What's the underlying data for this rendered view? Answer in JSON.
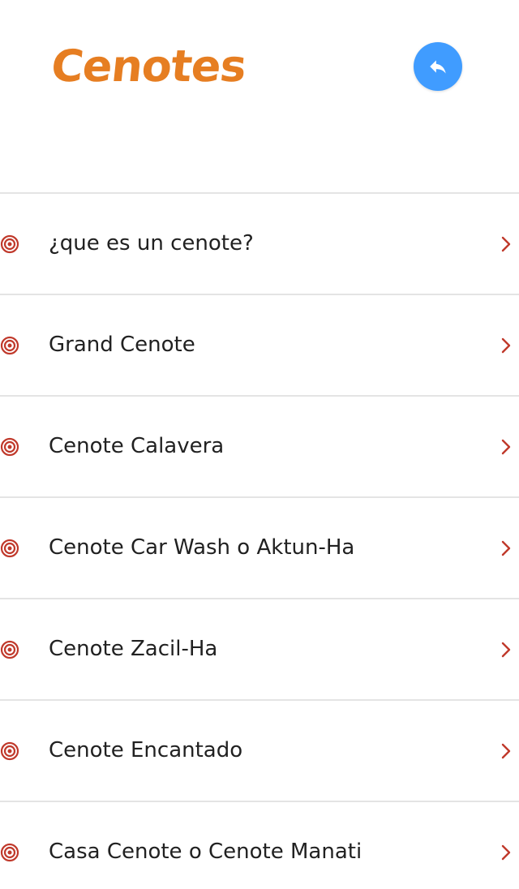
{
  "app": {
    "title": "Cenotes"
  },
  "colors": {
    "title": "#e67e22",
    "back_button_bg": "#409cff",
    "back_button_icon": "#ffffff",
    "item_icon": "#c0392b",
    "chevron": "#c0392b",
    "divider": "#e4e4e4",
    "text": "#212121"
  },
  "icons": {
    "back": "reply-arrow-icon",
    "item": "target-icon",
    "chevron": "chevron-right-icon"
  },
  "items": [
    {
      "label": "¿que es un cenote?"
    },
    {
      "label": "Grand Cenote"
    },
    {
      "label": "Cenote Calavera"
    },
    {
      "label": "Cenote Car Wash o Aktun-Ha"
    },
    {
      "label": "Cenote Zacil-Ha"
    },
    {
      "label": "Cenote Encantado"
    },
    {
      "label": "Casa Cenote o Cenote Manati"
    }
  ]
}
